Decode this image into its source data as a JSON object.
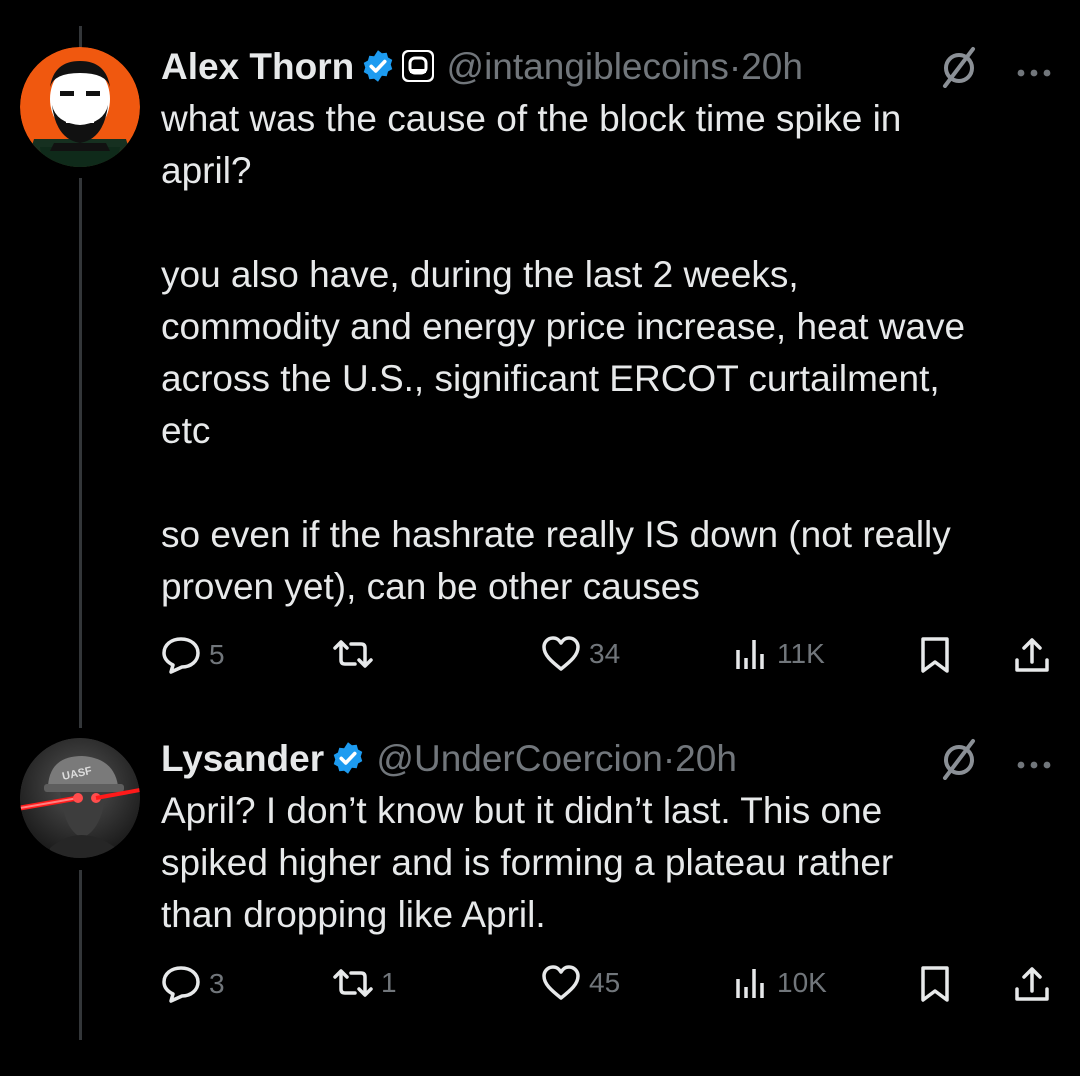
{
  "tweets": [
    {
      "name": "Alex Thorn",
      "handle": "@intangiblecoins",
      "separator": "·",
      "time": "20h",
      "lines": [
        "what was the cause of the block time spike in",
        "april?",
        "",
        "you also have, during the last 2 weeks,",
        "commodity and energy price increase, heat wave",
        "across the U.S., significant ERCOT curtailment,",
        "etc",
        "",
        "so even if the hashrate really IS down (not really",
        "proven yet), can be other causes"
      ],
      "replies": "5",
      "reposts": "",
      "likes": "34",
      "views": "11K"
    },
    {
      "name": "Lysander",
      "handle": "@UnderCoercion",
      "separator": "·",
      "time": "20h",
      "lines": [
        "April? I don’t know but it didn’t last. This one",
        "spiked higher and is forming a plateau rather",
        "than dropping like April."
      ],
      "replies": "3",
      "reposts": "1",
      "likes": "45",
      "views": "10K",
      "avatar_text": "UASF"
    }
  ],
  "colors": {
    "verified": "#1d9bf0",
    "avatar_orange": "#f0580f",
    "muted": "#71767b",
    "text": "#e7e9ea"
  }
}
